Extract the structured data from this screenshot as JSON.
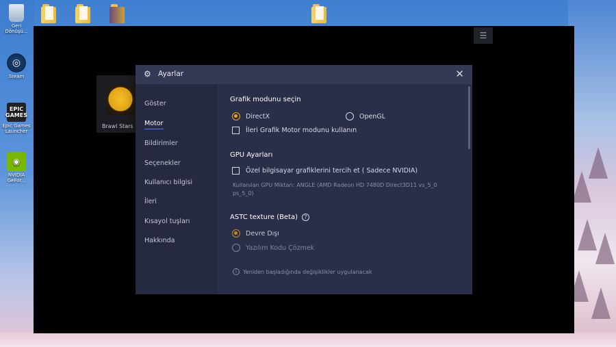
{
  "desktop": {
    "icons": [
      {
        "label": "Geri Dönüşü...",
        "name": "recycle-bin-icon"
      },
      {
        "label": "Steam",
        "name": "steam-icon"
      },
      {
        "label": "Epic Games Launcher",
        "name": "epic-games-icon"
      },
      {
        "label": "NVIDIA GeFor...",
        "name": "nvidia-icon"
      }
    ]
  },
  "game": {
    "name": "Brawl Stars"
  },
  "dialog": {
    "title": "Ayarlar",
    "close_icon": "close-icon",
    "sidebar": [
      {
        "label": "Göster"
      },
      {
        "label": "Motor"
      },
      {
        "label": "Bildirimler"
      },
      {
        "label": "Seçenekler"
      },
      {
        "label": "Kullanıcı bilgisi"
      },
      {
        "label": "İleri"
      },
      {
        "label": "Kısayol tuşları"
      },
      {
        "label": "Hakkında"
      }
    ],
    "active_item": "Motor",
    "graphics": {
      "title": "Grafik modunu seçin",
      "directx": "DirectX",
      "opengl": "OpenGL",
      "advanced": "İleri Grafik Motor modunu kullanın"
    },
    "gpu": {
      "title": "GPU Ayarları",
      "prefer": "Özel bilgisayar grafiklerini tercih et ( Sadece NVIDIA)",
      "info": "Kullanılan GPU Miktarı: ANGLE (AMD Radeon HD 7480D Direct3D11 vs_5_0 ps_5_0)"
    },
    "astc": {
      "title": "ASTC texture (Beta)",
      "disabled": "Devre Dışı",
      "software": "Yazılım Kodu Çözmek"
    },
    "footer": "Yeniden başladığında değişiklikler uygulanacak"
  },
  "colors": {
    "accent": "#f0a41c",
    "active_underline": "#4b7bff",
    "dialog_bg": "#2a2f49"
  }
}
